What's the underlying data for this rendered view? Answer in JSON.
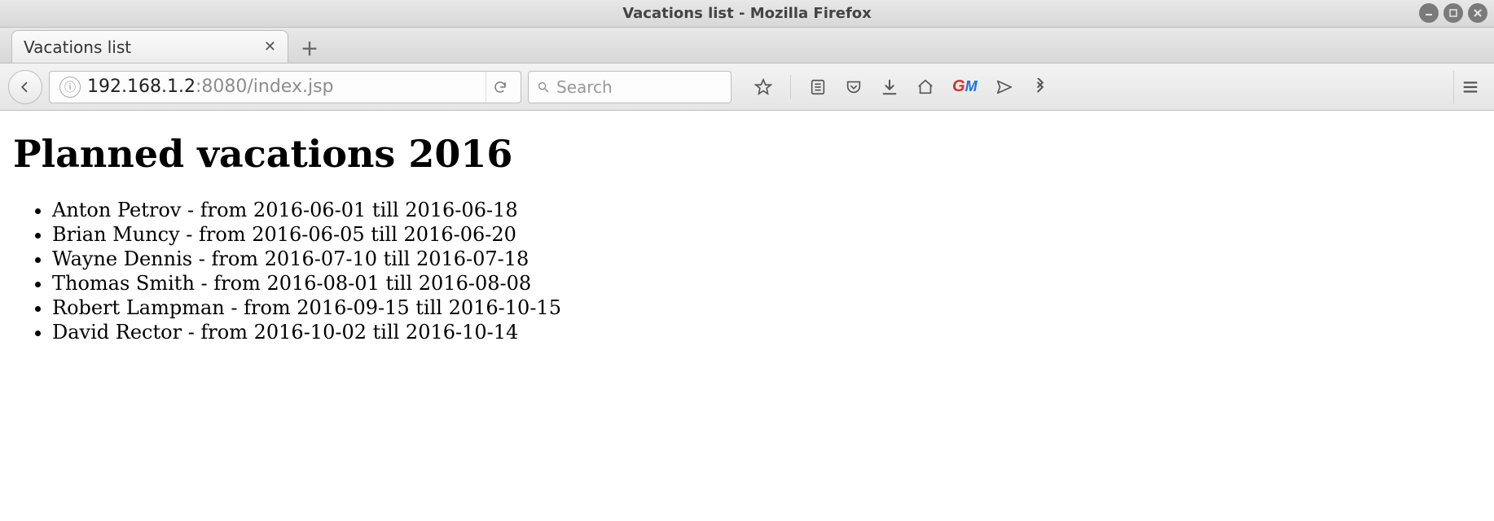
{
  "window_title": "Vacations list - Mozilla Firefox",
  "tab": {
    "label": "Vacations list"
  },
  "url": {
    "host": "192.168.1.2",
    "rest": ":8080/index.jsp"
  },
  "search": {
    "placeholder": "Search"
  },
  "page": {
    "heading": "Planned vacations 2016",
    "items": [
      "Anton Petrov - from 2016-06-01 till 2016-06-18",
      "Brian Muncy - from 2016-06-05 till 2016-06-20",
      "Wayne Dennis - from 2016-07-10 till 2016-07-18",
      "Thomas Smith - from 2016-08-01 till 2016-08-08",
      "Robert Lampman - from 2016-09-15 till 2016-10-15",
      "David Rector - from 2016-10-02 till 2016-10-14"
    ]
  }
}
